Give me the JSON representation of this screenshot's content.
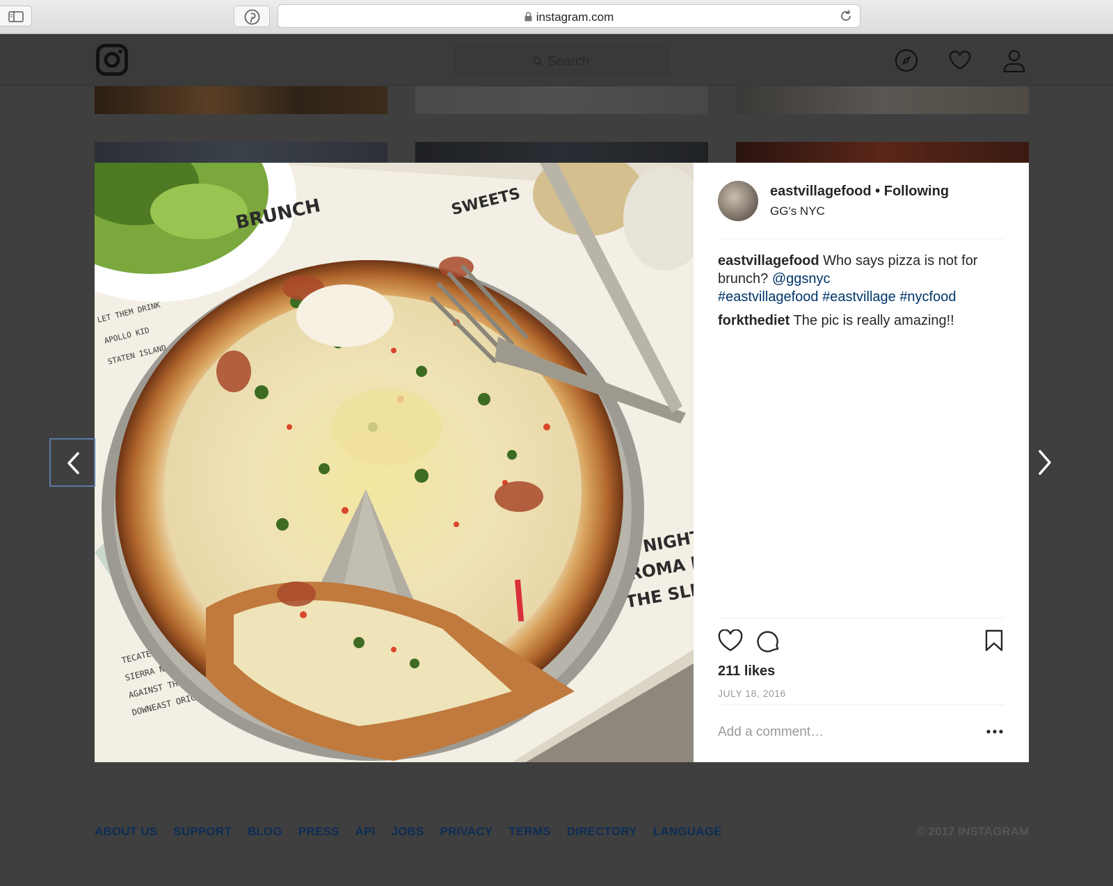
{
  "browser": {
    "url": "instagram.com"
  },
  "header": {
    "search_placeholder": "Search"
  },
  "post": {
    "username": "eastvillagefood",
    "separator": " • ",
    "follow_status": "Following",
    "location": "GG's NYC",
    "caption": {
      "user": "eastvillagefood",
      "text": " Who says pizza is not for brunch? ",
      "mention": "@ggsnyc",
      "hashtags": [
        "#eastvillagefood",
        "#eastvillage",
        "#nycfood"
      ]
    },
    "comments": [
      {
        "user": "forkthediet",
        "text": " The pic is really amazing!!"
      }
    ],
    "likes": "211 likes",
    "date": "JULY 18, 2016",
    "comment_placeholder": "Add a comment…"
  },
  "footer": {
    "links": [
      "ABOUT US",
      "SUPPORT",
      "BLOG",
      "PRESS",
      "API",
      "JOBS",
      "PRIVACY",
      "TERMS",
      "DIRECTORY",
      "LANGUAGE"
    ],
    "copyright": "© 2017 INSTAGRAM"
  },
  "colors": {
    "overlay": "#3f3f3f",
    "link": "#003569",
    "footer_link": "#0d2d57",
    "text": "#262626",
    "muted": "#999999"
  },
  "icons": [
    "sidebar-icon",
    "pinterest-icon",
    "lock-icon",
    "reload-icon",
    "instagram-logo-icon",
    "search-icon",
    "compass-icon",
    "heart-icon",
    "profile-icon",
    "like-icon",
    "comment-icon",
    "bookmark-icon",
    "more-icon",
    "chevron-left-icon",
    "chevron-right-icon"
  ]
}
